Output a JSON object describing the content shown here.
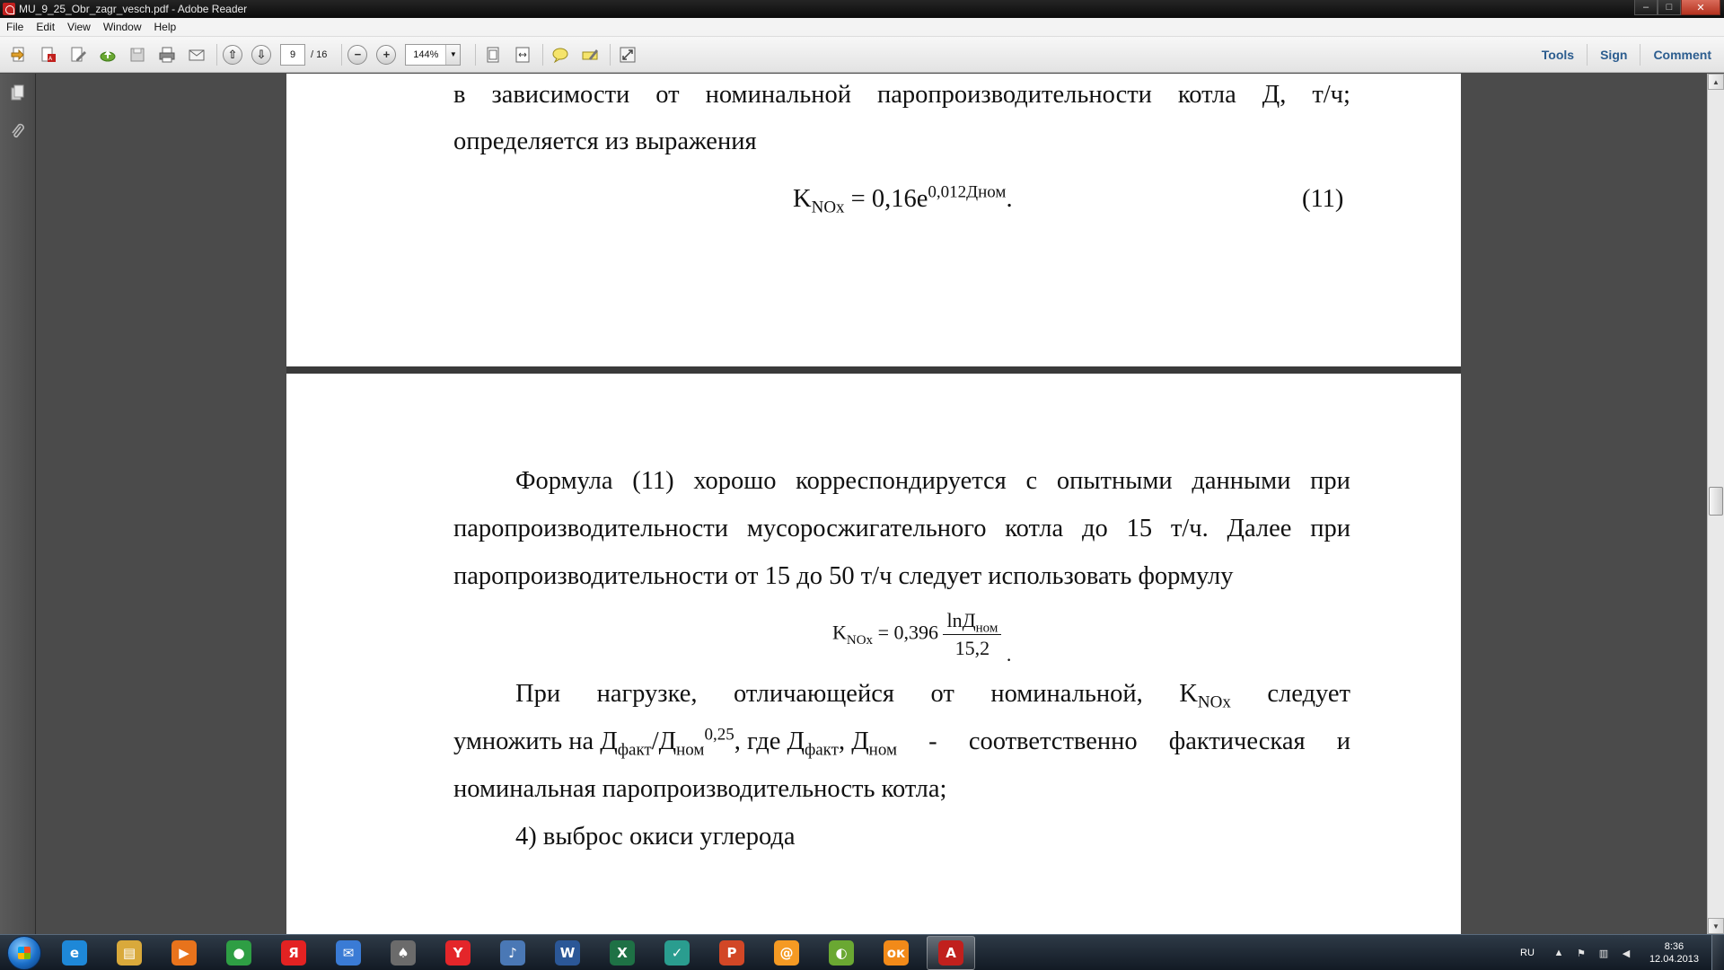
{
  "window": {
    "title": "MU_9_25_Obr_zagr_vesch.pdf - Adobe Reader",
    "controls": {
      "minimize": "–",
      "maximize": "□",
      "close": "✕"
    }
  },
  "menu": [
    "File",
    "Edit",
    "View",
    "Window",
    "Help"
  ],
  "toolbar": {
    "current_page": "9",
    "total_pages": "/ 16",
    "zoom": "144%",
    "zoom_out": "−",
    "zoom_in": "+",
    "right_links": {
      "tools": "Tools",
      "sign": "Sign",
      "comment": "Comment"
    },
    "icons": [
      "create-pdf-icon",
      "export-pdf-icon",
      "edit-pdf-icon",
      "cloud-upload-icon",
      "save-icon",
      "print-icon",
      "email-icon",
      "page-up-icon",
      "page-down-icon",
      "zoom-out-icon",
      "zoom-in-icon",
      "fit-page-icon",
      "fit-width-icon",
      "comment-bubble-icon",
      "highlight-icon",
      "full-screen-icon"
    ]
  },
  "document": {
    "page1": {
      "line1": [
        "в",
        "зависимости",
        "от",
        "номинальной",
        "паропроизводительности",
        "котла",
        "Д,",
        "т/ч;"
      ],
      "line2": "определяется из выражения",
      "eq": {
        "lhs": "K",
        "lhs_sub": "NOx",
        "rhs": " = 0,16e",
        "rhs_sup": "0,012Дном",
        "end": ".",
        "number": "(11)"
      }
    },
    "page2": {
      "para1_line1": [
        "Формула",
        "(11)",
        "хорошо",
        "корреспондируется",
        "с",
        "опытными",
        "данными",
        "при"
      ],
      "para1_line2": [
        "паропроизводительности",
        "мусоросжигательного",
        "котла",
        "до",
        "15",
        "т/ч.",
        "Далее",
        "при"
      ],
      "para1_line3": "паропроизводительности от 15 до 50 т/ч следует использовать формулу",
      "eq2": {
        "lhs": "K",
        "lhs_sub": "NOx",
        "mid": " = 0,396",
        "num": "lnД",
        "num_sub": "ном",
        "den": "15,2",
        "end": "."
      },
      "para2_line1": [
        "При",
        "нагрузке,",
        "отличающейся",
        "от",
        "номинальной,"
      ],
      "para2_k": "K",
      "para2_k_sub": "NOx",
      "para2_line1_end": "следует",
      "para2_line2": {
        "a": "умножить на Д",
        "a_sub": "факт",
        "b": "/Д",
        "b_sub": "ном",
        "b_sup": "0,25",
        "c": ", где Д",
        "c_sub": "факт",
        "d": ", Д",
        "d_sub": "ном",
        "e_words": [
          "-",
          "соответственно",
          "фактическая",
          "и"
        ]
      },
      "para2_line3": "номинальная паропроизводительность котла;",
      "item4": "4) выброс окиси углерода"
    }
  },
  "taskbar": {
    "apps": [
      {
        "name": "internet-explorer",
        "label": "e",
        "color": "#1e88d8"
      },
      {
        "name": "file-explorer",
        "label": "▤",
        "color": "#d9a93b"
      },
      {
        "name": "media-player",
        "label": "▶",
        "color": "#e8731c"
      },
      {
        "name": "chrome",
        "label": "●",
        "color": "#2e9e44"
      },
      {
        "name": "yandex",
        "label": "Я",
        "color": "#e32222"
      },
      {
        "name": "mail",
        "label": "✉",
        "color": "#3a7bd5"
      },
      {
        "name": "solitaire",
        "label": "♠",
        "color": "#6b6b6b"
      },
      {
        "name": "yandex-browser",
        "label": "Y",
        "color": "#e4262a"
      },
      {
        "name": "sound",
        "label": "♪",
        "color": "#4a78b5"
      },
      {
        "name": "word",
        "label": "W",
        "color": "#2b5797"
      },
      {
        "name": "excel",
        "label": "X",
        "color": "#1e7145"
      },
      {
        "name": "app-check",
        "label": "✓",
        "color": "#2a9d8f"
      },
      {
        "name": "powerpoint",
        "label": "P",
        "color": "#d24726"
      },
      {
        "name": "mail-agent",
        "label": "@",
        "color": "#f59a23"
      },
      {
        "name": "globe",
        "label": "◐",
        "color": "#6aa832"
      },
      {
        "name": "odnoklassniki",
        "label": "ок",
        "color": "#f28a19"
      },
      {
        "name": "adobe-reader",
        "label": "A",
        "color": "#c1201d"
      }
    ],
    "tray": {
      "lang": "RU",
      "time": "8:36",
      "date": "12.04.2013"
    }
  }
}
